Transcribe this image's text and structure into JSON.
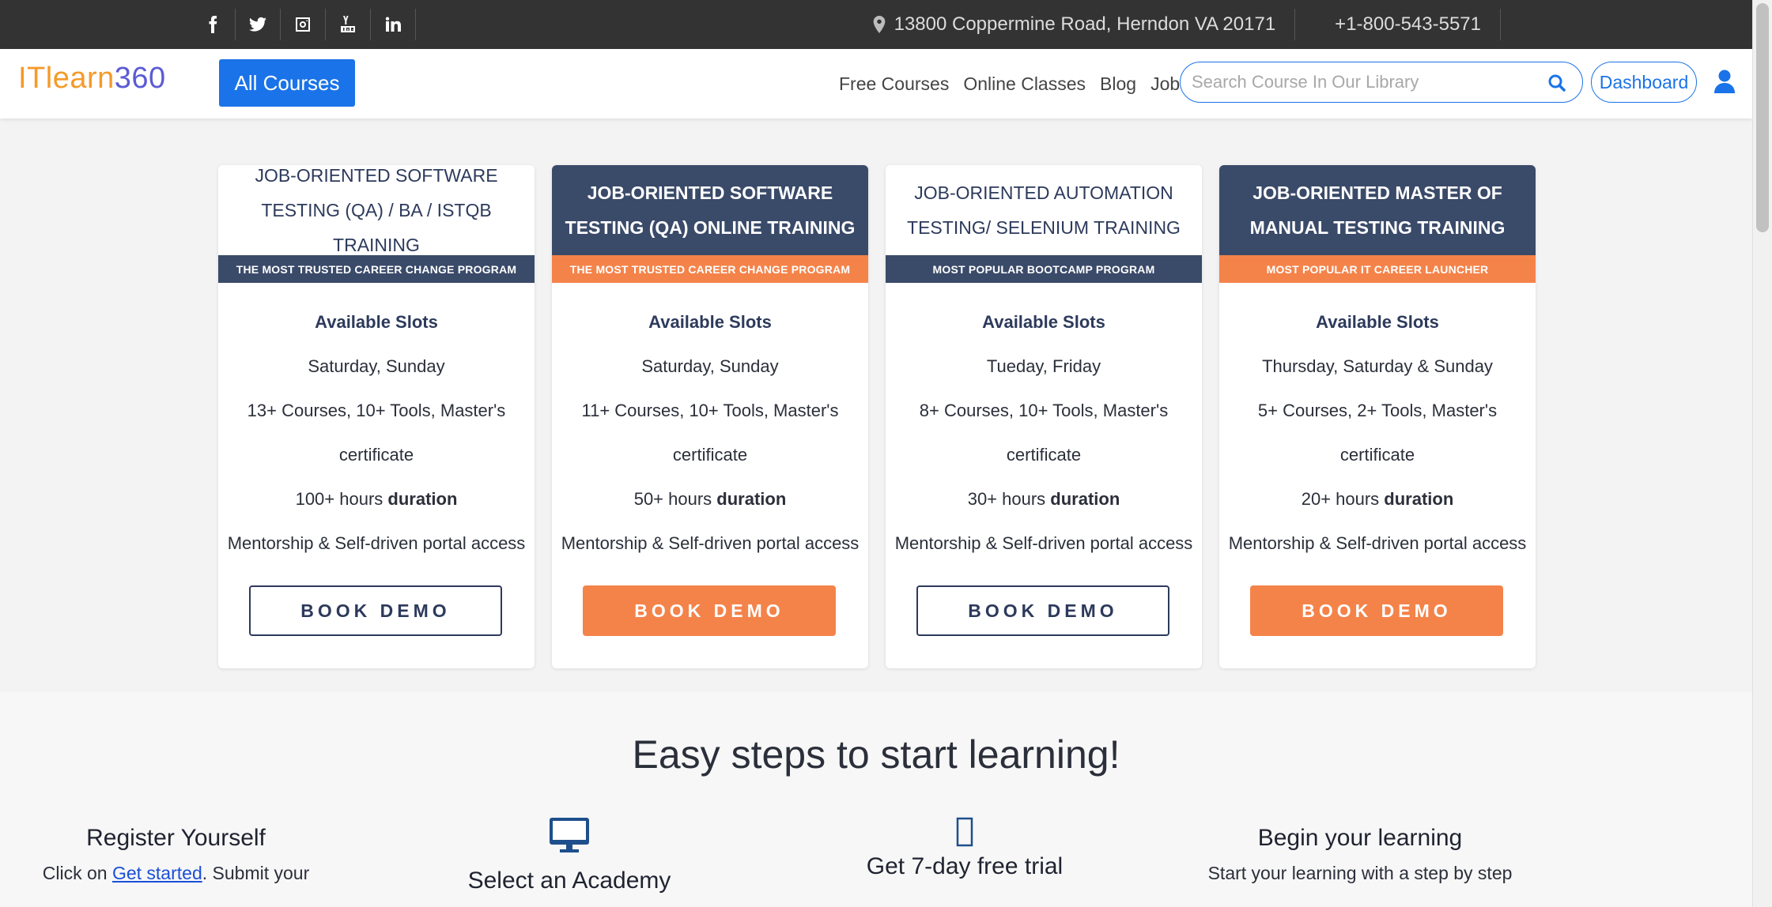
{
  "topbar": {
    "social": [
      {
        "name": "facebook-icon",
        "glyph": "f"
      },
      {
        "name": "twitter-icon",
        "glyph": "twitter"
      },
      {
        "name": "instagram-icon",
        "glyph": "instagram"
      },
      {
        "name": "youtube-icon",
        "glyph": "youtube"
      },
      {
        "name": "linkedin-icon",
        "glyph": "in"
      }
    ],
    "address": "13800 Coppermine Road, Herndon VA 20171",
    "phone": "+1-800-543-5571"
  },
  "nav": {
    "logo_part1": "ITlearn",
    "logo_part2": "360",
    "all_courses": "All Courses",
    "links": [
      "Free Courses",
      "Online Classes",
      "Blog",
      "Jobs"
    ],
    "search_placeholder": "Search Course In Our Library",
    "dashboard": "Dashboard"
  },
  "cards": [
    {
      "style": "light",
      "title": "JOB-ORIENTED SOFTWARE TESTING (QA) / BA / ISTQB TRAINING",
      "tag": "THE MOST TRUSTED CAREER CHANGE PROGRAM",
      "tag_color": "navy",
      "slots_label": "Available Slots",
      "days": "Saturday, Sunday",
      "courses_line1": "13+ Courses, 10+ Tools, Master's",
      "courses_line2": "certificate",
      "hours": "100+ hours",
      "duration": "duration",
      "mentorship": "Mentorship & Self-driven portal access",
      "button": "BOOK DEMO",
      "button_style": "outline"
    },
    {
      "style": "dark",
      "title": "JOB-ORIENTED SOFTWARE TESTING (QA) ONLINE TRAINING",
      "tag": "THE MOST TRUSTED CAREER CHANGE PROGRAM",
      "tag_color": "orange",
      "slots_label": "Available Slots",
      "days": "Saturday, Sunday",
      "courses_line1": "11+ Courses, 10+ Tools, Master's",
      "courses_line2": "certificate",
      "hours": "50+ hours",
      "duration": "duration",
      "mentorship": "Mentorship & Self-driven portal access",
      "button": "BOOK DEMO",
      "button_style": "filled"
    },
    {
      "style": "light",
      "title": "JOB-ORIENTED AUTOMATION TESTING/ SELENIUM TRAINING",
      "tag": "MOST POPULAR BOOTCAMP PROGRAM",
      "tag_color": "navy",
      "slots_label": "Available Slots",
      "days": "Tueday, Friday",
      "courses_line1": "8+ Courses, 10+ Tools, Master's",
      "courses_line2": "certificate",
      "hours": "30+ hours",
      "duration": "duration",
      "mentorship": "Mentorship & Self-driven portal access",
      "button": "BOOK DEMO",
      "button_style": "outline"
    },
    {
      "style": "dark",
      "title": "JOB-ORIENTED MASTER OF MANUAL TESTING TRAINING",
      "tag": "MOST POPULAR IT CAREER LAUNCHER",
      "tag_color": "orange",
      "slots_label": "Available Slots",
      "days": "Thursday, Saturday & Sunday",
      "courses_line1": "5+ Courses, 2+ Tools, Master's",
      "courses_line2": "certificate",
      "hours": "20+ hours",
      "duration": "duration",
      "mentorship": "Mentorship & Self-driven portal access",
      "button": "BOOK DEMO",
      "button_style": "filled"
    }
  ],
  "steps": {
    "title": "Easy steps to start learning!",
    "step1_title": "Register Yourself",
    "step1_text_pre": "Click on ",
    "step1_link": "Get started",
    "step1_text_post": ". Submit your",
    "step2_title": "Select an Academy",
    "step3_title": "Get 7-day free trial",
    "step4_title": "Begin your learning",
    "step4_text": "Start your learning with a step by step"
  },
  "colors": {
    "brand_blue": "#1a73e8",
    "navy": "#3a4a69",
    "orange": "#f4834a",
    "topbar": "#333333"
  }
}
